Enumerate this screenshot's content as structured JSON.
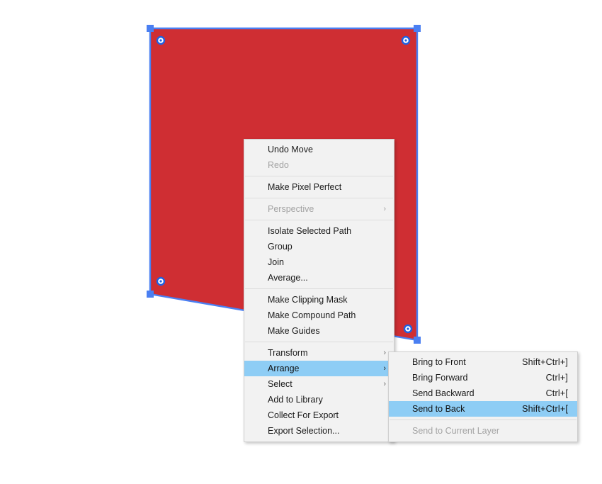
{
  "app": {
    "canvas_background": "#ffffff"
  },
  "artwork": {
    "name": "red-polygon-shape",
    "fill_color": "#cf2e33",
    "selection_color": "#4a7ff2",
    "anchor_fill": "#ffffff",
    "anchor_stroke": "#1f5fe0"
  },
  "context_menu": {
    "name": "canvas-context-menu",
    "items": [
      {
        "label": "Undo Move",
        "shortcut": "",
        "arrow": "",
        "disabled": false,
        "highlight": false,
        "separator_after": false
      },
      {
        "label": "Redo",
        "shortcut": "",
        "arrow": "",
        "disabled": true,
        "highlight": false,
        "separator_after": true
      },
      {
        "label": "Make Pixel Perfect",
        "shortcut": "",
        "arrow": "",
        "disabled": false,
        "highlight": false,
        "separator_after": true
      },
      {
        "label": "Perspective",
        "shortcut": "",
        "arrow": "›",
        "disabled": true,
        "highlight": false,
        "separator_after": true
      },
      {
        "label": "Isolate Selected Path",
        "shortcut": "",
        "arrow": "",
        "disabled": false,
        "highlight": false,
        "separator_after": false
      },
      {
        "label": "Group",
        "shortcut": "",
        "arrow": "",
        "disabled": false,
        "highlight": false,
        "separator_after": false
      },
      {
        "label": "Join",
        "shortcut": "",
        "arrow": "",
        "disabled": false,
        "highlight": false,
        "separator_after": false
      },
      {
        "label": "Average...",
        "shortcut": "",
        "arrow": "",
        "disabled": false,
        "highlight": false,
        "separator_after": true
      },
      {
        "label": "Make Clipping Mask",
        "shortcut": "",
        "arrow": "",
        "disabled": false,
        "highlight": false,
        "separator_after": false
      },
      {
        "label": "Make Compound Path",
        "shortcut": "",
        "arrow": "",
        "disabled": false,
        "highlight": false,
        "separator_after": false
      },
      {
        "label": "Make Guides",
        "shortcut": "",
        "arrow": "",
        "disabled": false,
        "highlight": false,
        "separator_after": true
      },
      {
        "label": "Transform",
        "shortcut": "",
        "arrow": "›",
        "disabled": false,
        "highlight": false,
        "separator_after": false
      },
      {
        "label": "Arrange",
        "shortcut": "",
        "arrow": "›",
        "disabled": false,
        "highlight": true,
        "separator_after": false
      },
      {
        "label": "Select",
        "shortcut": "",
        "arrow": "›",
        "disabled": false,
        "highlight": false,
        "separator_after": false
      },
      {
        "label": "Add to Library",
        "shortcut": "",
        "arrow": "",
        "disabled": false,
        "highlight": false,
        "separator_after": false
      },
      {
        "label": "Collect For Export",
        "shortcut": "",
        "arrow": "",
        "disabled": false,
        "highlight": false,
        "separator_after": false
      },
      {
        "label": "Export Selection...",
        "shortcut": "",
        "arrow": "",
        "disabled": false,
        "highlight": false,
        "separator_after": false
      }
    ]
  },
  "arrange_submenu": {
    "name": "arrange-submenu",
    "items": [
      {
        "label": "Bring to Front",
        "shortcut": "Shift+Ctrl+]",
        "arrow": "",
        "disabled": false,
        "highlight": false,
        "separator_after": false
      },
      {
        "label": "Bring Forward",
        "shortcut": "Ctrl+]",
        "arrow": "",
        "disabled": false,
        "highlight": false,
        "separator_after": false
      },
      {
        "label": "Send Backward",
        "shortcut": "Ctrl+[",
        "arrow": "",
        "disabled": false,
        "highlight": false,
        "separator_after": false
      },
      {
        "label": "Send to Back",
        "shortcut": "Shift+Ctrl+[",
        "arrow": "",
        "disabled": false,
        "highlight": true,
        "separator_after": true
      },
      {
        "label": "Send to Current Layer",
        "shortcut": "",
        "arrow": "",
        "disabled": true,
        "highlight": false,
        "separator_after": false
      }
    ]
  },
  "theme": {
    "menu_background": "#f2f2f2",
    "menu_border": "#cfcfcf",
    "highlight_color": "#8ecdf5",
    "disabled_text": "#a3a3a3",
    "separator_color": "#dcdcdc"
  }
}
